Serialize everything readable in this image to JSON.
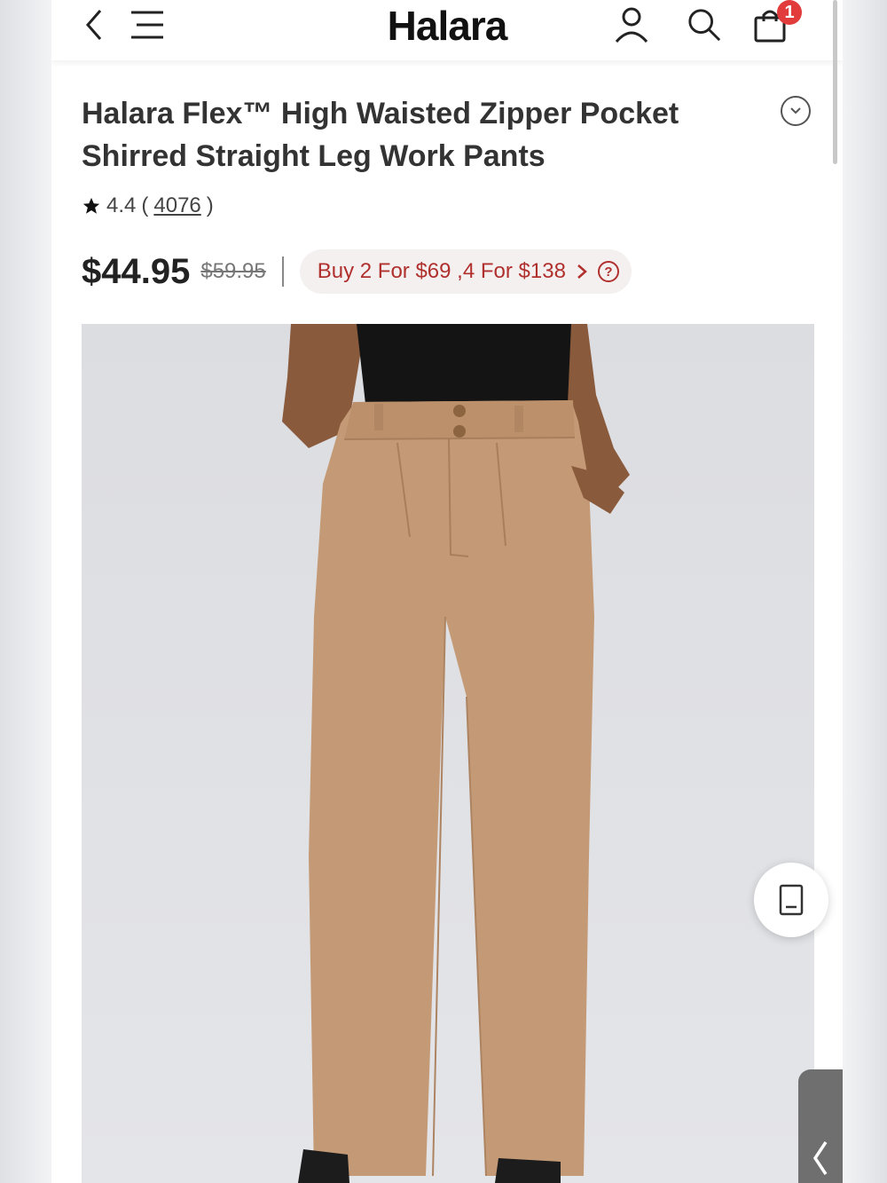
{
  "header": {
    "logo": "Halara",
    "cart_count": "1",
    "icons": [
      "back-icon",
      "menu-icon",
      "account-icon",
      "search-icon",
      "shopping-bag-icon"
    ]
  },
  "product": {
    "title_line1": "Halara Flex™ High Waisted Zipper Pocket",
    "title_line2": "Shirred Straight Leg Work Pants",
    "rating": "4.4",
    "review_open": "(",
    "review_count": "4076",
    "review_close": ")",
    "price": "$44.95",
    "original_price": "$59.95",
    "promo": "Buy 2 For $69 ,4 For $138",
    "promo_help": "?"
  },
  "colors": {
    "accent_red": "#b0302e",
    "badge_red": "#e23b3b",
    "pants": "#c49a76"
  }
}
